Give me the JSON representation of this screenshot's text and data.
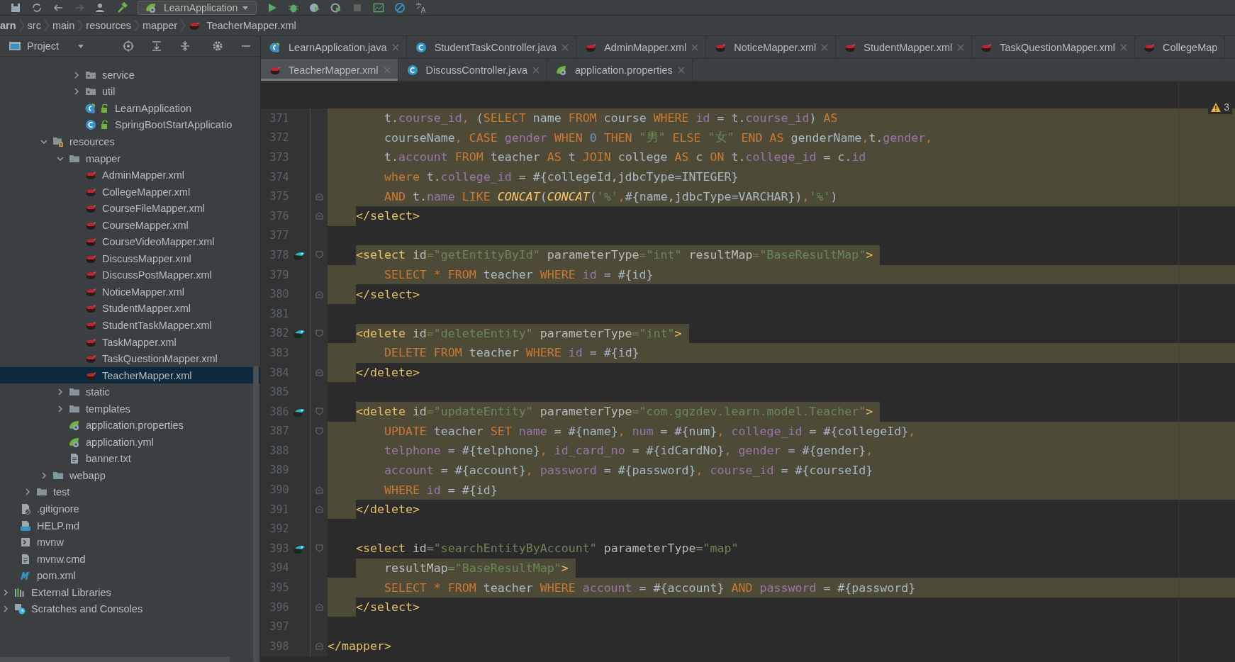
{
  "toolbar": {
    "run_config": "LearnApplication"
  },
  "breadcrumb": [
    "arn",
    "src",
    "main",
    "resources",
    "mapper",
    "TeacherMapper.xml"
  ],
  "project_panel": {
    "title": "Project",
    "tree": [
      {
        "children": [
          {
            "children": [
              {
                "children": [
                  {
                    "children": [
                      {
                        "children": [
                          {
                            "label": "service",
                            "kind": "package",
                            "expanded": false,
                            "selected": false
                          },
                          {
                            "label": "util",
                            "kind": "package",
                            "expanded": false,
                            "selected": false
                          },
                          {
                            "label": "LearnApplication",
                            "kind": "spring-class",
                            "selected": false
                          },
                          {
                            "label": "SpringBootStartApplicatio",
                            "kind": "class",
                            "selected": false
                          }
                        ]
                      }
                    ]
                  },
                  {
                    "label": "resources",
                    "kind": "resources",
                    "expanded": true,
                    "selected": false,
                    "children": [
                      {
                        "label": "mapper",
                        "kind": "folder",
                        "expanded": true,
                        "selected": false,
                        "children": [
                          {
                            "label": "AdminMapper.xml",
                            "kind": "mybatis",
                            "selected": false
                          },
                          {
                            "label": "CollegeMapper.xml",
                            "kind": "mybatis",
                            "selected": false
                          },
                          {
                            "label": "CourseFileMapper.xml",
                            "kind": "mybatis",
                            "selected": false
                          },
                          {
                            "label": "CourseMapper.xml",
                            "kind": "mybatis",
                            "selected": false
                          },
                          {
                            "label": "CourseVideoMapper.xml",
                            "kind": "mybatis",
                            "selected": false
                          },
                          {
                            "label": "DiscussMapper.xml",
                            "kind": "mybatis",
                            "selected": false
                          },
                          {
                            "label": "DiscussPostMapper.xml",
                            "kind": "mybatis",
                            "selected": false
                          },
                          {
                            "label": "NoticeMapper.xml",
                            "kind": "mybatis",
                            "selected": false
                          },
                          {
                            "label": "StudentMapper.xml",
                            "kind": "mybatis",
                            "selected": false
                          },
                          {
                            "label": "StudentTaskMapper.xml",
                            "kind": "mybatis",
                            "selected": false
                          },
                          {
                            "label": "TaskMapper.xml",
                            "kind": "mybatis",
                            "selected": false
                          },
                          {
                            "label": "TaskQuestionMapper.xml",
                            "kind": "mybatis",
                            "selected": false
                          },
                          {
                            "label": "TeacherMapper.xml",
                            "kind": "mybatis",
                            "selected": true
                          }
                        ]
                      },
                      {
                        "label": "static",
                        "kind": "folder",
                        "expanded": false,
                        "selected": false
                      },
                      {
                        "label": "templates",
                        "kind": "folder",
                        "expanded": false,
                        "selected": false
                      },
                      {
                        "label": "application.properties",
                        "kind": "spring-config",
                        "selected": false
                      },
                      {
                        "label": "application.yml",
                        "kind": "spring-config",
                        "selected": false
                      },
                      {
                        "label": "banner.txt",
                        "kind": "text-file",
                        "selected": false
                      }
                    ]
                  },
                  {
                    "label": "webapp",
                    "kind": "web-folder",
                    "expanded": false,
                    "selected": false
                  }
                ]
              },
              {
                "label": "test",
                "kind": "folder",
                "expanded": false,
                "selected": false
              }
            ]
          },
          {
            "label": ".gitignore",
            "kind": "ignore-file",
            "selected": false
          },
          {
            "label": "HELP.md",
            "kind": "md-file",
            "selected": false
          },
          {
            "label": "mvnw",
            "kind": "shell-file",
            "selected": false
          },
          {
            "label": "mvnw.cmd",
            "kind": "text-file",
            "selected": false
          },
          {
            "label": "pom.xml",
            "kind": "maven",
            "selected": false
          }
        ]
      },
      {
        "label": "External Libraries",
        "kind": "libraries",
        "expanded": false,
        "selected": false
      },
      {
        "label": "Scratches and Consoles",
        "kind": "scratches",
        "expanded": false,
        "selected": false
      }
    ]
  },
  "tab_rows": [
    [
      {
        "label": "LearnApplication.java",
        "kind": "spring-class",
        "selected": false
      },
      {
        "label": "StudentTaskController.java",
        "kind": "class",
        "selected": false
      },
      {
        "label": "AdminMapper.xml",
        "kind": "mybatis",
        "selected": false
      },
      {
        "label": "NoticeMapper.xml",
        "kind": "mybatis",
        "selected": false
      },
      {
        "label": "StudentMapper.xml",
        "kind": "mybatis",
        "selected": false
      },
      {
        "label": "TaskQuestionMapper.xml",
        "kind": "mybatis",
        "selected": false
      },
      {
        "label": "CollegeMap",
        "kind": "mybatis",
        "selected": false
      }
    ],
    [
      {
        "label": "TeacherMapper.xml",
        "kind": "mybatis",
        "selected": true
      },
      {
        "label": "DiscussController.java",
        "kind": "class",
        "selected": false
      },
      {
        "label": "application.properties",
        "kind": "spring-config",
        "selected": false
      }
    ]
  ],
  "editor": {
    "warning_count": "3",
    "lines": [
      {
        "number": "371",
        "kind": "sql-block",
        "tokens": [
          {
            "kind": "plain",
            "text": "t."
          },
          {
            "kind": "col",
            "text": "course_id"
          },
          {
            "kind": "kw",
            "text": ","
          },
          {
            "kind": "plain",
            "text": " ("
          },
          {
            "kind": "kw",
            "text": "SELECT"
          },
          {
            "kind": "plain",
            "text": " name "
          },
          {
            "kind": "kw",
            "text": "FROM"
          },
          {
            "kind": "plain",
            "text": " course "
          },
          {
            "kind": "kw",
            "text": "WHERE"
          },
          {
            "kind": "col",
            "text": " id"
          },
          {
            "kind": "plain",
            "text": " = t."
          },
          {
            "kind": "col",
            "text": "course_id"
          },
          {
            "kind": "plain",
            "text": ") "
          },
          {
            "kind": "kw",
            "text": "AS"
          }
        ]
      },
      {
        "number": "372",
        "kind": "sql-block",
        "tokens": [
          {
            "kind": "plain",
            "text": "courseName"
          },
          {
            "kind": "kw",
            "text": ", CASE"
          },
          {
            "kind": "col",
            "text": " gender"
          },
          {
            "kind": "kw",
            "text": " WHEN"
          },
          {
            "kind": "num",
            "text": " 0"
          },
          {
            "kind": "kw",
            "text": " THEN"
          },
          {
            "kind": "str",
            "text": " \"男\""
          },
          {
            "kind": "kw",
            "text": " ELSE"
          },
          {
            "kind": "str",
            "text": " \"女\""
          },
          {
            "kind": "kw",
            "text": " END AS"
          },
          {
            "kind": "plain",
            "text": " genderName"
          },
          {
            "kind": "kw",
            "text": ","
          },
          {
            "kind": "plain",
            "text": "t."
          },
          {
            "kind": "col",
            "text": "gender"
          },
          {
            "kind": "kw",
            "text": ","
          }
        ]
      },
      {
        "number": "373",
        "kind": "sql-block",
        "tokens": [
          {
            "kind": "plain",
            "text": "t."
          },
          {
            "kind": "col",
            "text": "account"
          },
          {
            "kind": "kw",
            "text": " FROM"
          },
          {
            "kind": "plain",
            "text": " teacher "
          },
          {
            "kind": "kw",
            "text": "AS"
          },
          {
            "kind": "plain",
            "text": " t "
          },
          {
            "kind": "kw",
            "text": "JOIN"
          },
          {
            "kind": "plain",
            "text": " college "
          },
          {
            "kind": "kw",
            "text": "AS"
          },
          {
            "kind": "plain",
            "text": " c "
          },
          {
            "kind": "kw",
            "text": "ON"
          },
          {
            "kind": "plain",
            "text": " t."
          },
          {
            "kind": "col",
            "text": "college_id"
          },
          {
            "kind": "plain",
            "text": " = c."
          },
          {
            "kind": "col",
            "text": "id"
          }
        ]
      },
      {
        "number": "374",
        "kind": "sql-block",
        "tokens": [
          {
            "kind": "kw",
            "text": "where"
          },
          {
            "kind": "plain",
            "text": " t."
          },
          {
            "kind": "col",
            "text": "college_id"
          },
          {
            "kind": "plain",
            "text": " = #{collegeId,jdbcType=INTEGER}"
          }
        ]
      },
      {
        "number": "375",
        "kind": "sql-block",
        "fold_end": true,
        "tokens": [
          {
            "kind": "kw",
            "text": "AND"
          },
          {
            "kind": "plain",
            "text": " t."
          },
          {
            "kind": "col",
            "text": "name"
          },
          {
            "kind": "kw",
            "text": " LIKE "
          },
          {
            "kind": "fn",
            "text": "CONCAT"
          },
          {
            "kind": "plain",
            "text": "("
          },
          {
            "kind": "fn",
            "text": "CONCAT"
          },
          {
            "kind": "plain",
            "text": "("
          },
          {
            "kind": "str",
            "text": "'%'"
          },
          {
            "kind": "kw",
            "text": ","
          },
          {
            "kind": "plain",
            "text": "#{name,jdbcType=VARCHAR})"
          },
          {
            "kind": "kw",
            "text": ","
          },
          {
            "kind": "str",
            "text": "'%'"
          },
          {
            "kind": "plain",
            "text": ")"
          }
        ]
      },
      {
        "number": "376",
        "kind": "tag-lead",
        "fold_end": true,
        "tokens": [
          {
            "kind": "tag",
            "text": "</select>"
          }
        ]
      },
      {
        "number": "377",
        "kind": "blank"
      },
      {
        "number": "378",
        "kind": "tag-text",
        "fold_start": true,
        "mapper": true,
        "tokens": [
          {
            "kind": "tag",
            "text": "<select"
          },
          {
            "kind": "attr",
            "text": " id"
          },
          {
            "kind": "str",
            "text": "=\"getEntityById\""
          },
          {
            "kind": "attr",
            "text": " parameterType"
          },
          {
            "kind": "str",
            "text": "=\"int\""
          },
          {
            "kind": "attr",
            "text": " resultMap"
          },
          {
            "kind": "str",
            "text": "=\"BaseResultMap\""
          },
          {
            "kind": "tag",
            "text": ">"
          }
        ]
      },
      {
        "number": "379",
        "kind": "sql-block",
        "tokens": [
          {
            "kind": "kw",
            "text": "SELECT * FROM"
          },
          {
            "kind": "plain",
            "text": " teacher "
          },
          {
            "kind": "kw",
            "text": "WHERE"
          },
          {
            "kind": "col",
            "text": " id"
          },
          {
            "kind": "plain",
            "text": " = #{id}"
          }
        ]
      },
      {
        "number": "380",
        "kind": "tag-lead",
        "fold_end": true,
        "tokens": [
          {
            "kind": "tag",
            "text": "</select>"
          }
        ]
      },
      {
        "number": "381",
        "kind": "blank"
      },
      {
        "number": "382",
        "kind": "tag-text",
        "fold_start": true,
        "mapper": true,
        "tokens": [
          {
            "kind": "tag",
            "text": "<delete"
          },
          {
            "kind": "attr",
            "text": " id"
          },
          {
            "kind": "str",
            "text": "=\"deleteEntity\""
          },
          {
            "kind": "attr",
            "text": " parameterType"
          },
          {
            "kind": "str",
            "text": "=\"int\""
          },
          {
            "kind": "tag",
            "text": ">"
          }
        ]
      },
      {
        "number": "383",
        "kind": "sql-block",
        "tokens": [
          {
            "kind": "kw",
            "text": "DELETE FROM"
          },
          {
            "kind": "plain",
            "text": " teacher "
          },
          {
            "kind": "kw",
            "text": "WHERE"
          },
          {
            "kind": "col",
            "text": " id"
          },
          {
            "kind": "plain",
            "text": " = #{id}"
          }
        ]
      },
      {
        "number": "384",
        "kind": "tag-lead",
        "fold_end": true,
        "tokens": [
          {
            "kind": "tag",
            "text": "</delete>"
          }
        ]
      },
      {
        "number": "385",
        "kind": "blank"
      },
      {
        "number": "386",
        "kind": "tag-text",
        "fold_start": true,
        "mapper": true,
        "tokens": [
          {
            "kind": "tag",
            "text": "<delete"
          },
          {
            "kind": "attr",
            "text": " id"
          },
          {
            "kind": "str",
            "text": "=\"updateEntity\""
          },
          {
            "kind": "attr",
            "text": " parameterType"
          },
          {
            "kind": "str",
            "text": "=\"com.gqzdev.learn.model.Teacher\""
          },
          {
            "kind": "tag",
            "text": ">"
          }
        ]
      },
      {
        "number": "387",
        "kind": "sql-block",
        "fold_start": true,
        "tokens": [
          {
            "kind": "kw",
            "text": "UPDATE"
          },
          {
            "kind": "plain",
            "text": " teacher "
          },
          {
            "kind": "kw",
            "text": "SET"
          },
          {
            "kind": "col",
            "text": " name"
          },
          {
            "kind": "plain",
            "text": " = #{name}"
          },
          {
            "kind": "kw",
            "text": ","
          },
          {
            "kind": "col",
            "text": " num"
          },
          {
            "kind": "plain",
            "text": " = #{num}"
          },
          {
            "kind": "kw",
            "text": ","
          },
          {
            "kind": "col",
            "text": " college_id"
          },
          {
            "kind": "plain",
            "text": " = #{collegeId}"
          },
          {
            "kind": "kw",
            "text": ","
          }
        ]
      },
      {
        "number": "388",
        "kind": "sql-block",
        "tokens": [
          {
            "kind": "col",
            "text": "telphone"
          },
          {
            "kind": "plain",
            "text": " = #{telphone}"
          },
          {
            "kind": "kw",
            "text": ","
          },
          {
            "kind": "col",
            "text": " id_card_no"
          },
          {
            "kind": "plain",
            "text": " = #{idCardNo}"
          },
          {
            "kind": "kw",
            "text": ","
          },
          {
            "kind": "col",
            "text": " gender"
          },
          {
            "kind": "plain",
            "text": " = #{gender}"
          },
          {
            "kind": "kw",
            "text": ","
          }
        ]
      },
      {
        "number": "389",
        "kind": "sql-block",
        "tokens": [
          {
            "kind": "col",
            "text": "account"
          },
          {
            "kind": "plain",
            "text": " = #{account}"
          },
          {
            "kind": "kw",
            "text": ","
          },
          {
            "kind": "col",
            "text": " password"
          },
          {
            "kind": "plain",
            "text": " = #{password}"
          },
          {
            "kind": "kw",
            "text": ","
          },
          {
            "kind": "col",
            "text": " course_id"
          },
          {
            "kind": "plain",
            "text": " = #{courseId}"
          }
        ]
      },
      {
        "number": "390",
        "kind": "sql-block",
        "fold_end": true,
        "tokens": [
          {
            "kind": "kw",
            "text": "WHERE"
          },
          {
            "kind": "col",
            "text": " id"
          },
          {
            "kind": "plain",
            "text": " = #{id}"
          }
        ]
      },
      {
        "number": "391",
        "kind": "tag-lead",
        "fold_end": true,
        "tokens": [
          {
            "kind": "tag",
            "text": "</delete>"
          }
        ]
      },
      {
        "number": "392",
        "kind": "blank"
      },
      {
        "number": "393",
        "kind": "tag",
        "fold_start": true,
        "mapper": true,
        "tokens": [
          {
            "kind": "tag",
            "text": "<select"
          },
          {
            "kind": "attr",
            "text": " id"
          },
          {
            "kind": "str",
            "text": "=\"searchEntityByAccount\""
          },
          {
            "kind": "attr",
            "text": " parameterType"
          },
          {
            "kind": "str",
            "text": "=\"map\""
          }
        ]
      },
      {
        "number": "394",
        "kind": "attr-text",
        "tokens": [
          {
            "kind": "attr",
            "text": "resultMap"
          },
          {
            "kind": "str",
            "text": "=\"BaseResultMap\""
          },
          {
            "kind": "tag",
            "text": ">"
          }
        ]
      },
      {
        "number": "395",
        "kind": "sql-block",
        "tokens": [
          {
            "kind": "kw",
            "text": "SELECT * FROM"
          },
          {
            "kind": "plain",
            "text": " teacher "
          },
          {
            "kind": "kw",
            "text": "WHERE"
          },
          {
            "kind": "col",
            "text": " account"
          },
          {
            "kind": "plain",
            "text": " = #{account} "
          },
          {
            "kind": "kw",
            "text": "AND"
          },
          {
            "kind": "col",
            "text": " password"
          },
          {
            "kind": "plain",
            "text": " = #{password}"
          }
        ]
      },
      {
        "number": "396",
        "kind": "tag-lead",
        "fold_end": true,
        "tokens": [
          {
            "kind": "tag",
            "text": "</select>"
          }
        ]
      },
      {
        "number": "397",
        "kind": "blank"
      },
      {
        "number": "398",
        "kind": "root",
        "fold_end": true,
        "tokens": [
          {
            "kind": "tag",
            "text": "</mapper>"
          }
        ]
      }
    ]
  }
}
